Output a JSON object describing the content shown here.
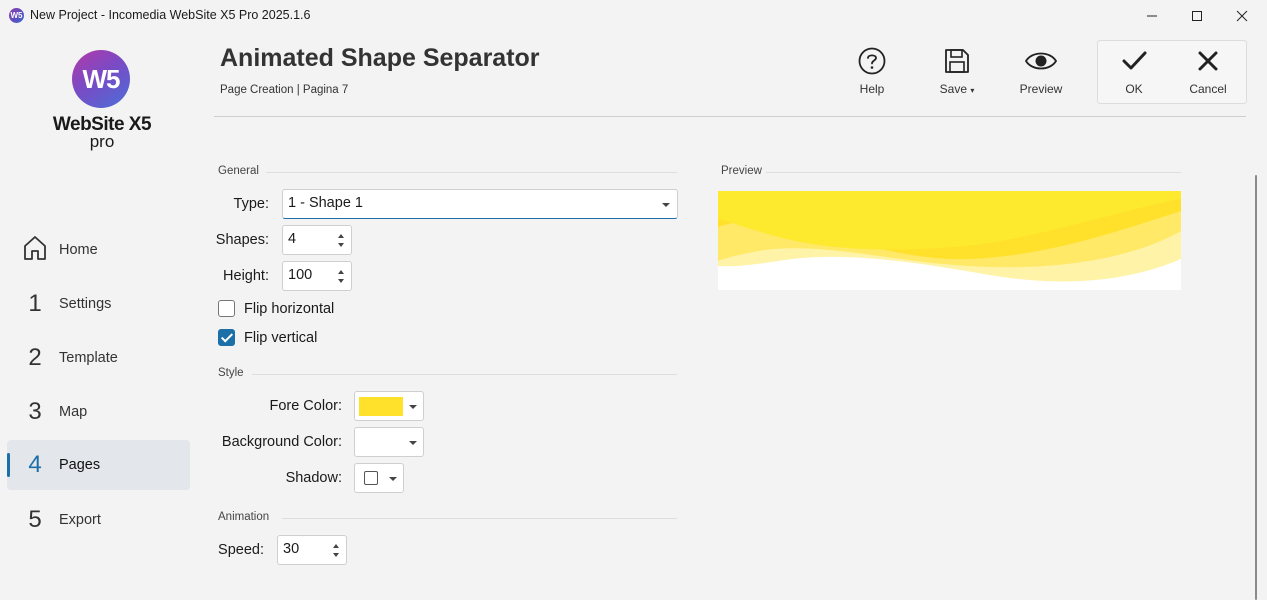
{
  "window": {
    "title": "New Project - Incomedia WebSite X5 Pro 2025.1.6",
    "app_icon_text": "W5"
  },
  "logo": {
    "mark": "W5",
    "name": "WebSite X5",
    "edition": "pro"
  },
  "sidebar": {
    "items": [
      {
        "icon": "home-icon",
        "label": "Home"
      },
      {
        "num": "1",
        "label": "Settings"
      },
      {
        "num": "2",
        "label": "Template"
      },
      {
        "num": "3",
        "label": "Map"
      },
      {
        "num": "4",
        "label": "Pages",
        "active": true
      },
      {
        "num": "5",
        "label": "Export"
      }
    ]
  },
  "header": {
    "title": "Animated Shape Separator",
    "breadcrumb": "Page Creation | Pagina 7"
  },
  "toolbar": {
    "help_label": "Help",
    "save_label": "Save",
    "preview_label": "Preview",
    "ok_label": "OK",
    "cancel_label": "Cancel"
  },
  "general": {
    "section_label": "General",
    "type_label": "Type:",
    "type_value": "1 - Shape 1",
    "shapes_label": "Shapes:",
    "shapes_value": "4",
    "height_label": "Height:",
    "height_value": "100",
    "flip_h_label": "Flip horizontal",
    "flip_h_checked": false,
    "flip_v_label": "Flip vertical",
    "flip_v_checked": true
  },
  "style": {
    "section_label": "Style",
    "fore_color_label": "Fore Color:",
    "fore_color": "#ffe02a",
    "background_color_label": "Background Color:",
    "background_color": "#ffffff",
    "shadow_label": "Shadow:",
    "shadow_checked": false
  },
  "animation": {
    "section_label": "Animation",
    "speed_label": "Speed:",
    "speed_value": "30"
  },
  "preview": {
    "section_label": "Preview",
    "colors": {
      "base": "#ffe02a",
      "light": "#fff0a0"
    }
  },
  "accent": "#1d6fa8"
}
